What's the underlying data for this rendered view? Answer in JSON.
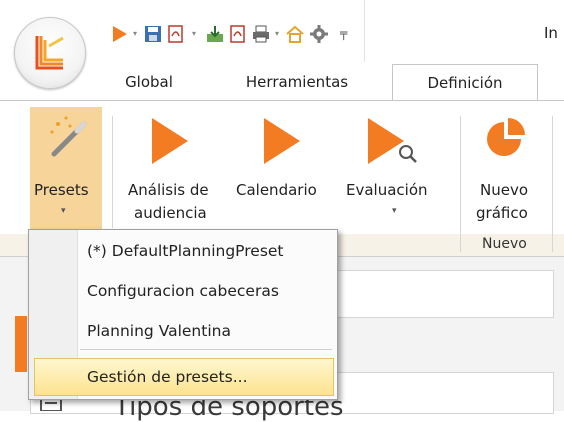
{
  "quick_access": {
    "title_fragment": "In",
    "icons": [
      "play-icon",
      "save-icon",
      "pdf-export-icon",
      "download-icon",
      "pdf-icon",
      "print-icon",
      "home-icon",
      "gear-icon",
      "customize-icon"
    ]
  },
  "tabs": [
    {
      "label": "Global"
    },
    {
      "label": "Herramientas"
    },
    {
      "label": "Definición",
      "active": true
    }
  ],
  "ribbon": {
    "presets": {
      "label": "Presets",
      "caret": "▾"
    },
    "analisis": {
      "line1": "Análisis de",
      "line2": "audiencia"
    },
    "calendario": {
      "label": "Calendario"
    },
    "evaluacion": {
      "label": "Evaluación",
      "caret": "▾"
    },
    "nuevo_grafico": {
      "line1": "Nuevo",
      "line2": "gráfico"
    },
    "group_nuevo": "Nuevo"
  },
  "dropdown": {
    "items": [
      "(*) DefaultPlanningPreset",
      "Configuracion cabeceras",
      "Planning Valentina"
    ],
    "manage": "Gestión de presets..."
  },
  "lower": {
    "heading": "Tipos de soportes"
  },
  "colors": {
    "accent_orange": "#f37b21",
    "presets_highlight": "#f6d49a",
    "menu_hover": "#fde38f"
  }
}
